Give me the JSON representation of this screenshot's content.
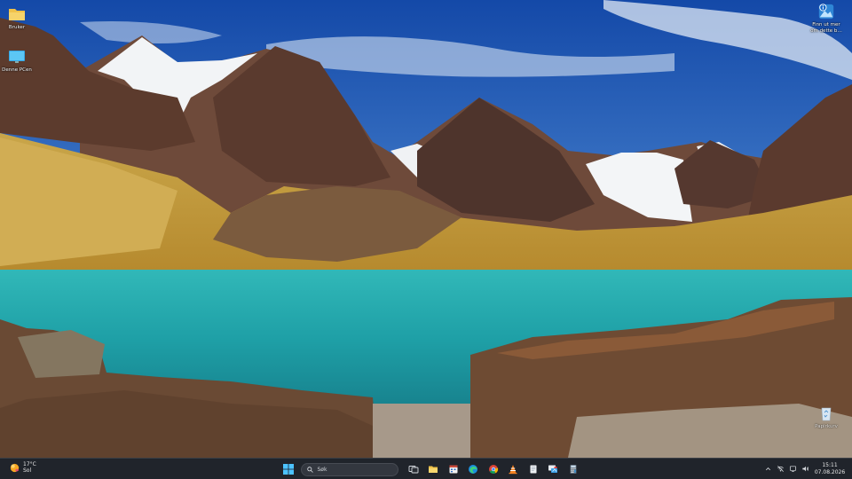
{
  "desktop": {
    "icons": [
      {
        "label": "Bruker",
        "icon": "folder-icon"
      },
      {
        "label": "Denne PCen",
        "icon": "monitor-icon"
      },
      {
        "label": "Finn ut mer\nom dette b…",
        "icon": "learn-more-icon"
      },
      {
        "label": "Papirkurv",
        "icon": "recycle-bin-icon"
      }
    ]
  },
  "taskbar": {
    "weather": {
      "temp": "17°C",
      "condition": "Sol",
      "icon": "sun-icon"
    },
    "search": {
      "placeholder": "Søk"
    },
    "pinned_apps": [
      {
        "name": "task-view",
        "icon": "task-view-icon"
      },
      {
        "name": "file-explorer",
        "icon": "folder-icon"
      },
      {
        "name": "calendar",
        "icon": "calendar-icon"
      },
      {
        "name": "edge",
        "icon": "edge-icon"
      },
      {
        "name": "chrome",
        "icon": "chrome-icon"
      },
      {
        "name": "vlc",
        "icon": "vlc-icon"
      },
      {
        "name": "notepad",
        "icon": "notepad-icon"
      },
      {
        "name": "remote-desktop",
        "icon": "remote-desktop-icon"
      },
      {
        "name": "calculator",
        "icon": "calculator-icon"
      }
    ],
    "tray": [
      "chevron-up-icon",
      "network-off-icon",
      "display-icon",
      "volume-icon"
    ],
    "clock": {
      "time": "15:11",
      "date": "07.08.2026"
    }
  },
  "colors": {
    "taskbar_bg": "#20242b",
    "sky": "#1e5fb8",
    "lake": "#1fa3a5",
    "accent": "#4cc2ff"
  }
}
